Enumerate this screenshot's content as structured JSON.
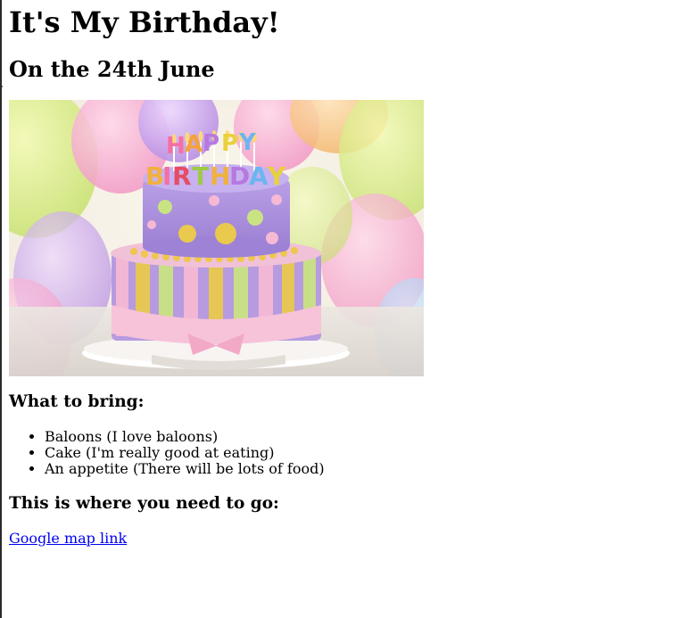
{
  "page": {
    "title": "It's My Birthday!",
    "date": "On the 24th June"
  },
  "hero_image": {
    "alt": "Birthday cake with HAPPY BIRTHDAY candles",
    "candle_text_top": "HAPPY",
    "candle_text_bottom": "BIRTHDAY"
  },
  "bring": {
    "heading": "What to bring:",
    "items": [
      "Baloons (I love baloons)",
      "Cake (I'm really good at eating)",
      "An appetite (There will be lots of food)"
    ]
  },
  "directions": {
    "heading": "This is where you need to go:",
    "link_text": "Google map link"
  },
  "colors": {
    "link": "#0000ee",
    "cake_purple": "#b79be0",
    "cake_yellow": "#e9c94e",
    "icing_pink": "#f6b9d4"
  }
}
